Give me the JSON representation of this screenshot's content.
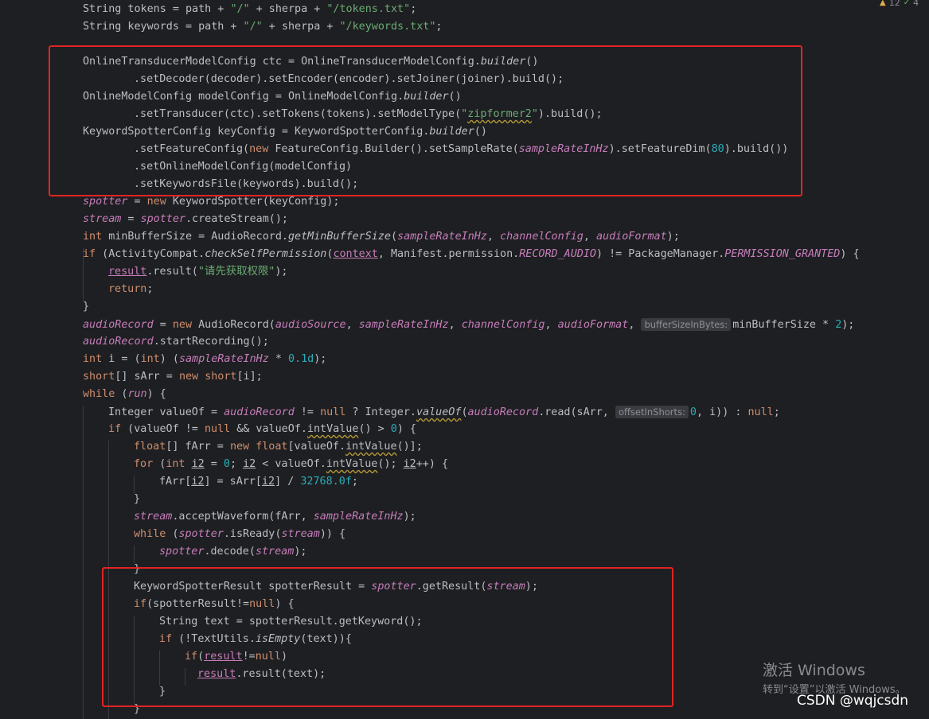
{
  "problems": {
    "warnings": "12",
    "checks": "4"
  },
  "code": {
    "l01": [
      "String tokens = path + ",
      "\"/\"",
      " + sherpa + ",
      "\"/tokens.txt\"",
      ";"
    ],
    "l02": [
      "String keywords = path + ",
      "\"/\"",
      " + sherpa + ",
      "\"/keywords.txt\"",
      ";"
    ],
    "l04": [
      "OnlineTransducerModelConfig ctc = OnlineTransducerModelConfig.",
      "builder",
      "()"
    ],
    "l05": ".setDecoder(decoder).setEncoder(encoder).setJoiner(joiner).build();",
    "l06": [
      "OnlineModelConfig modelConfig = OnlineModelConfig.",
      "builder",
      "()"
    ],
    "l07": [
      ".setTransducer(ctc).setTokens(tokens).setModelType(",
      "\"",
      "zipformer2",
      "\"",
      ").build();"
    ],
    "l08": [
      "KeywordSpotterConfig keyConfig = KeywordSpotterConfig.",
      "builder",
      "()"
    ],
    "l09": [
      ".setFeatureConfig(",
      "new",
      " FeatureConfig.Builder().setSampleRate(",
      "sampleRateInHz",
      ").setFeatureDim(",
      "80",
      ").build())"
    ],
    "l10": ".setOnlineModelConfig(modelConfig)",
    "l11": ".setKeywordsFile(keywords).build();",
    "l12": [
      "spotter",
      " = ",
      "new",
      " KeywordSpotter(keyConfig);"
    ],
    "l13": [
      "stream",
      " = ",
      "spotter",
      ".createStream();"
    ],
    "l14": [
      "int",
      " minBufferSize = AudioRecord.",
      "getMinBufferSize",
      "(",
      "sampleRateInHz",
      ", ",
      "channelConfig",
      ", ",
      "audioFormat",
      ");"
    ],
    "l15": [
      "if",
      " (ActivityCompat.",
      "checkSelfPermission",
      "(",
      "context",
      ", Manifest.permission.",
      "RECORD_AUDIO",
      ") != PackageManager.",
      "PERMISSION_GRANTED",
      ") {"
    ],
    "l16": [
      "result",
      ".result(",
      "\"请先获取权限\"",
      ");"
    ],
    "l17": [
      "return",
      ";"
    ],
    "l18": "}",
    "l19": [
      "audioRecord",
      " = ",
      "new",
      " AudioRecord(",
      "audioSource",
      ", ",
      "sampleRateInHz",
      ", ",
      "channelConfig",
      ", ",
      "audioFormat",
      ", ",
      "bufferSizeInBytes:",
      "minBufferSize * ",
      "2",
      ");"
    ],
    "l20": [
      "audioRecord",
      ".startRecording();"
    ],
    "l21": [
      "int",
      " i = (",
      "int",
      ") (",
      "sampleRateInHz",
      " * ",
      "0.1d",
      ");"
    ],
    "l22": [
      "short",
      "[] sArr = ",
      "new",
      " ",
      "short",
      "[i];"
    ],
    "l23": [
      "while",
      " (",
      "run",
      ") {"
    ],
    "l24": [
      "Integer valueOf = ",
      "audioRecord",
      " != ",
      "null",
      " ? Integer.",
      "valueOf",
      "(",
      "audioRecord",
      ".read(sArr, ",
      "offsetInShorts:",
      "0",
      ", i)) : ",
      "null",
      ";"
    ],
    "l25": [
      "if",
      " (valueOf != ",
      "null",
      " && valueOf.",
      "intValue",
      "() > ",
      "0",
      ") {"
    ],
    "l26": [
      "float",
      "[] fArr = ",
      "new",
      " ",
      "float",
      "[valueOf.",
      "intValue",
      "()];"
    ],
    "l27": [
      "for",
      " (",
      "int",
      " ",
      "i2",
      " = ",
      "0",
      "; ",
      "i2",
      " < valueOf.",
      "intValue",
      "(); ",
      "i2",
      "++) {"
    ],
    "l28": [
      "fArr[",
      "i2",
      "] = sArr[",
      "i2",
      "] / ",
      "32768.0f",
      ";"
    ],
    "l29": "}",
    "l30": [
      "stream",
      ".acceptWaveform(fArr, ",
      "sampleRateInHz",
      ");"
    ],
    "l31": [
      "while",
      " (",
      "spotter",
      ".isReady(",
      "stream",
      ")) {"
    ],
    "l32": [
      "spotter",
      ".decode(",
      "stream",
      ");"
    ],
    "l33": "}",
    "l34": [
      "KeywordSpotterResult spotterResult = ",
      "spotter",
      ".getResult(",
      "stream",
      ");"
    ],
    "l35": [
      "if",
      "(spotterResult!=",
      "null",
      ") {"
    ],
    "l36": "String text = spotterResult.getKeyword();",
    "l37": [
      "if",
      " (!TextUtils.",
      "isEmpty",
      "(text)){"
    ],
    "l38": [
      "if",
      "(",
      "result",
      "!=",
      "null",
      ")"
    ],
    "l39": [
      "result",
      ".result(text);"
    ],
    "l40": "}",
    "l41": "}"
  },
  "overlay": {
    "activate_title": "激活 Windows",
    "activate_sub": "转到“设置”以激活 Windows。",
    "watermark": "CSDN @wqjcsdn"
  },
  "colors": {
    "background": "#1e1f22",
    "text": "#bcbec4",
    "keyword": "#cf8e6d",
    "string": "#6aab73",
    "number": "#2aacb8",
    "field": "#c77dbb",
    "highlight_box": "#e02424"
  }
}
